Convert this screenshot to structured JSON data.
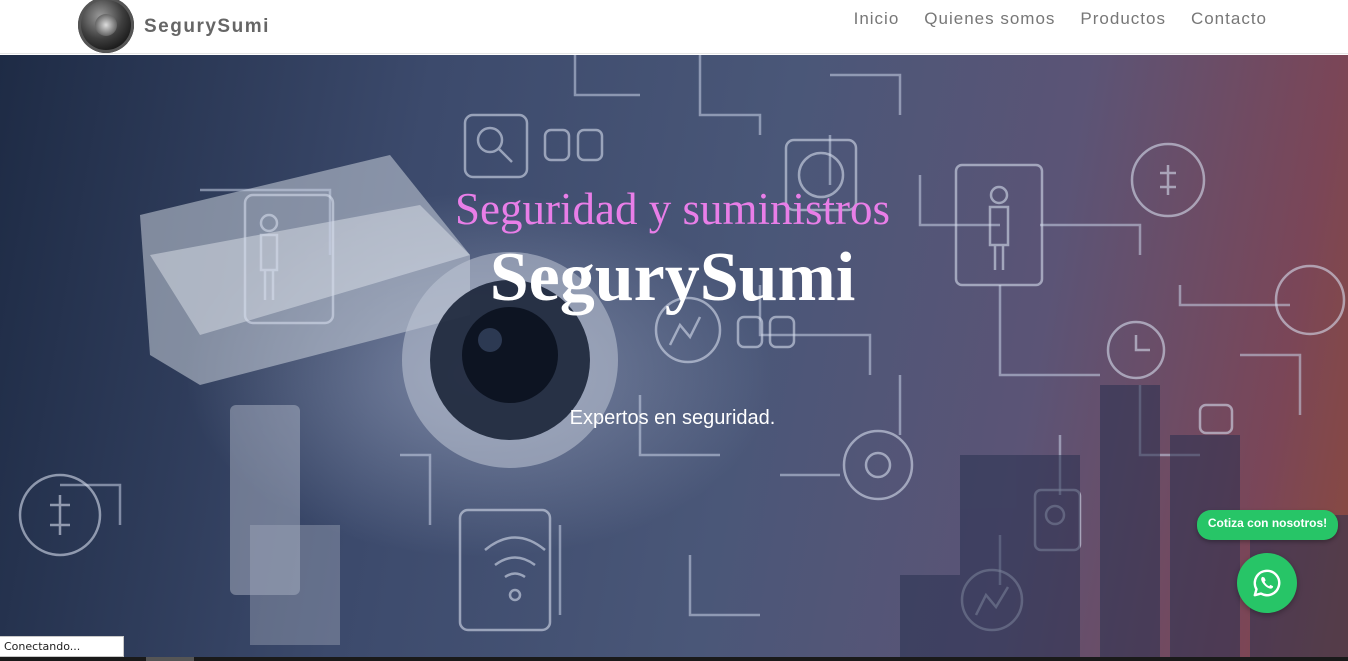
{
  "brand": {
    "name": "SegurySumi",
    "logo_icon": "vault-dial-icon"
  },
  "nav": {
    "items": [
      {
        "label": "Inicio"
      },
      {
        "label": "Quienes somos"
      },
      {
        "label": "Productos"
      },
      {
        "label": "Contacto"
      }
    ]
  },
  "hero": {
    "subtitle": "Seguridad y suministros",
    "title": "SegurySumi",
    "tagline": "Expertos en seguridad.",
    "background_icon": "security-camera-network-image"
  },
  "whatsapp": {
    "label": "Cotiza con nosotros!",
    "icon": "whatsapp-icon",
    "color": "#27c567"
  },
  "status_bar": {
    "text": "Conectando..."
  },
  "colors": {
    "subtitle": "#e97ee8",
    "title": "#ffffff",
    "nav_text": "#777777"
  }
}
